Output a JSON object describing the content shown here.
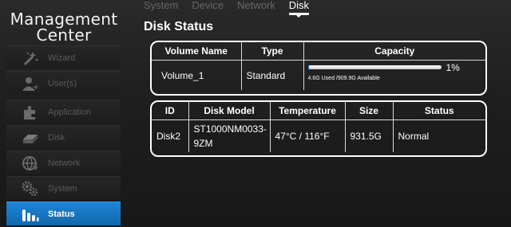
{
  "brand": {
    "line1": "Management",
    "line2": "Center"
  },
  "nav": [
    {
      "label": "Wizard",
      "icon": "wand-icon"
    },
    {
      "label": "User(s)",
      "icon": "user-icon"
    },
    {
      "label": "Application",
      "icon": "puzzle-icon"
    },
    {
      "label": "Disk",
      "icon": "disk-icon"
    },
    {
      "label": "Network",
      "icon": "globe-icon"
    },
    {
      "label": "System",
      "icon": "gears-icon"
    },
    {
      "label": "Status",
      "icon": "status-bars-icon",
      "active": true
    }
  ],
  "tabs": [
    "System",
    "Device",
    "Network",
    "Disk"
  ],
  "active_tab": "Disk",
  "page_title": "Disk Status",
  "volume_table": {
    "headers": [
      "Volume Name",
      "Type",
      "Capacity"
    ],
    "rows": [
      {
        "name": "Volume_1",
        "type": "Standard",
        "usage_percent": 1,
        "usage_percent_label": "1%",
        "capacity_text": "4.6G Used /909.9G Available"
      }
    ]
  },
  "disk_table": {
    "headers": [
      "ID",
      "Disk Model",
      "Temperature",
      "Size",
      "Status"
    ],
    "rows": [
      {
        "id": "Disk2",
        "model": "ST1000NM0033-9ZM",
        "temperature": "47°C / 116°F",
        "size": "931.5G",
        "status": "Normal"
      }
    ]
  },
  "colors": {
    "accent": "#1a7bc9",
    "inactive_label": "#5a5a5a",
    "progress_fill": "#2a7fd0"
  }
}
